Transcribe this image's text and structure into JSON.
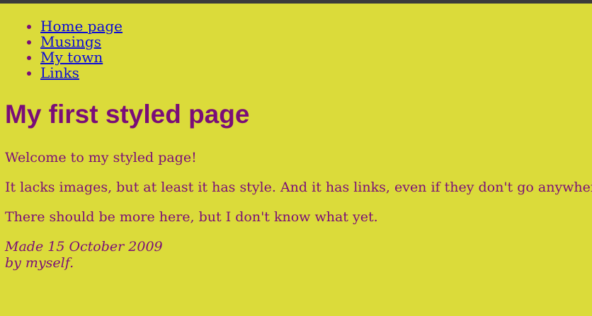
{
  "nav": {
    "items": [
      {
        "label": "Home page"
      },
      {
        "label": "Musings"
      },
      {
        "label": "My town"
      },
      {
        "label": "Links"
      }
    ]
  },
  "main": {
    "title": "My first styled page",
    "paragraphs": [
      "Welcome to my styled page!",
      "It lacks images, but at least it has style. And it has links, even if they don't go anywhere…",
      "There should be more here, but I don't know what yet."
    ]
  },
  "footer": {
    "made_line": "Made 15 October 2009",
    "by_line": "by myself",
    "by_suffix": "."
  },
  "colors": {
    "background": "#dbdb3a",
    "text": "#7a0d78",
    "link": "#0b0bd6",
    "top_bar": "#3b3b3b"
  }
}
